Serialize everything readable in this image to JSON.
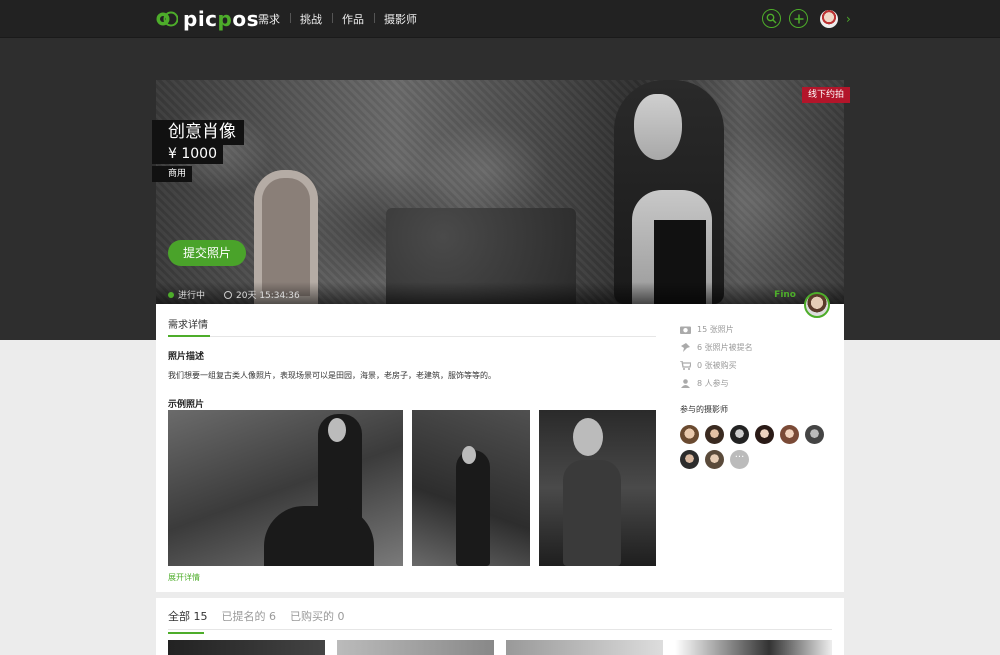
{
  "brand": {
    "name_pre": "pic",
    "name_accent": "p",
    "name_post": "os",
    "green": "#4dad2a"
  },
  "nav": {
    "items": [
      "需求",
      "挑战",
      "作品",
      "摄影师"
    ]
  },
  "top_actions": {
    "search_icon": "search-icon",
    "add_icon": "plus-icon",
    "more": "›"
  },
  "hero": {
    "badge": "线下约拍",
    "title": "创意肖像",
    "price": "¥ 1000",
    "usage": "商用",
    "submit_label": "提交照片",
    "status": "进行中",
    "time_left": "20天 15:34:36",
    "author": "Fino"
  },
  "details": {
    "tab": "需求详情",
    "photo_desc_title": "照片描述",
    "photo_desc": "我们想要一组复古类人像照片，表现场景可以是田园，海景，老房子，老建筑，服饰等等的。",
    "samples_title": "示例照片",
    "more_link": "展开详情"
  },
  "stats": [
    {
      "icon": "camera-icon",
      "text": "15 张照片"
    },
    {
      "icon": "pin-icon",
      "text": "6 张照片被提名"
    },
    {
      "icon": "cart-icon",
      "text": "0 张被购买"
    },
    {
      "icon": "user-icon",
      "text": "8 人参与"
    }
  ],
  "participants": {
    "title": "参与的摄影师",
    "more": "···"
  },
  "bottom_tabs": [
    "全部 15",
    "已提名的 6",
    "已购买的 0"
  ]
}
